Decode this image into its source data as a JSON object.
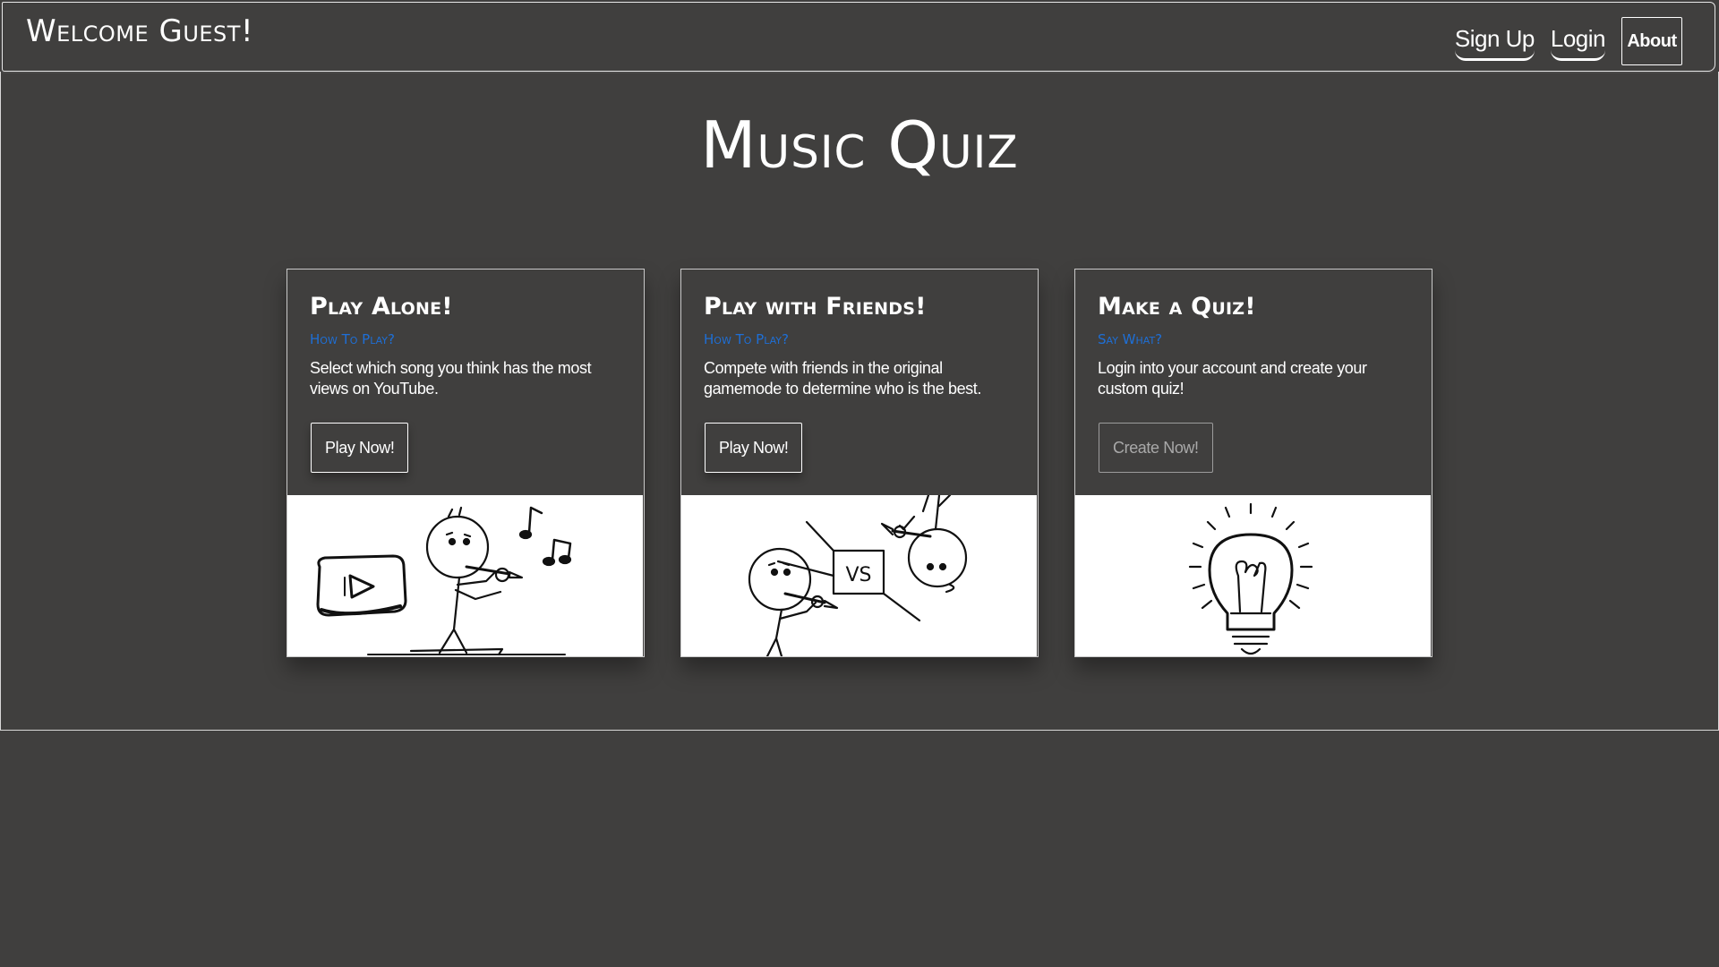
{
  "header": {
    "brand": "Welcome Guest!",
    "sign_up": "Sign Up",
    "login": "Login",
    "about": "About"
  },
  "page_title": "Music Quiz",
  "cards": [
    {
      "title": "Play Alone!",
      "subtitle": "How To Play?",
      "text": "Select which song you think has the most views on YouTube.",
      "button": "Play Now!",
      "image": "stick-figure-music-youtube",
      "button_enabled": true
    },
    {
      "title": "Play with Friends!",
      "subtitle": "How To Play?",
      "text": "Compete with friends in the original gamemode to determine who is the best.",
      "button": "Play Now!",
      "image": "stick-figures-versus",
      "vs_label": "VS",
      "button_enabled": true
    },
    {
      "title": "Make a Quiz!",
      "subtitle": "Say What?",
      "text": "Login into your account and create your custom quiz!",
      "button": "Create Now!",
      "image": "lightbulb-sketch",
      "button_enabled": false
    }
  ],
  "colors": {
    "background": "#403f3e",
    "accent_link": "#1e6fd6",
    "text": "#ffffff",
    "card_image_bg": "#ffffff"
  }
}
